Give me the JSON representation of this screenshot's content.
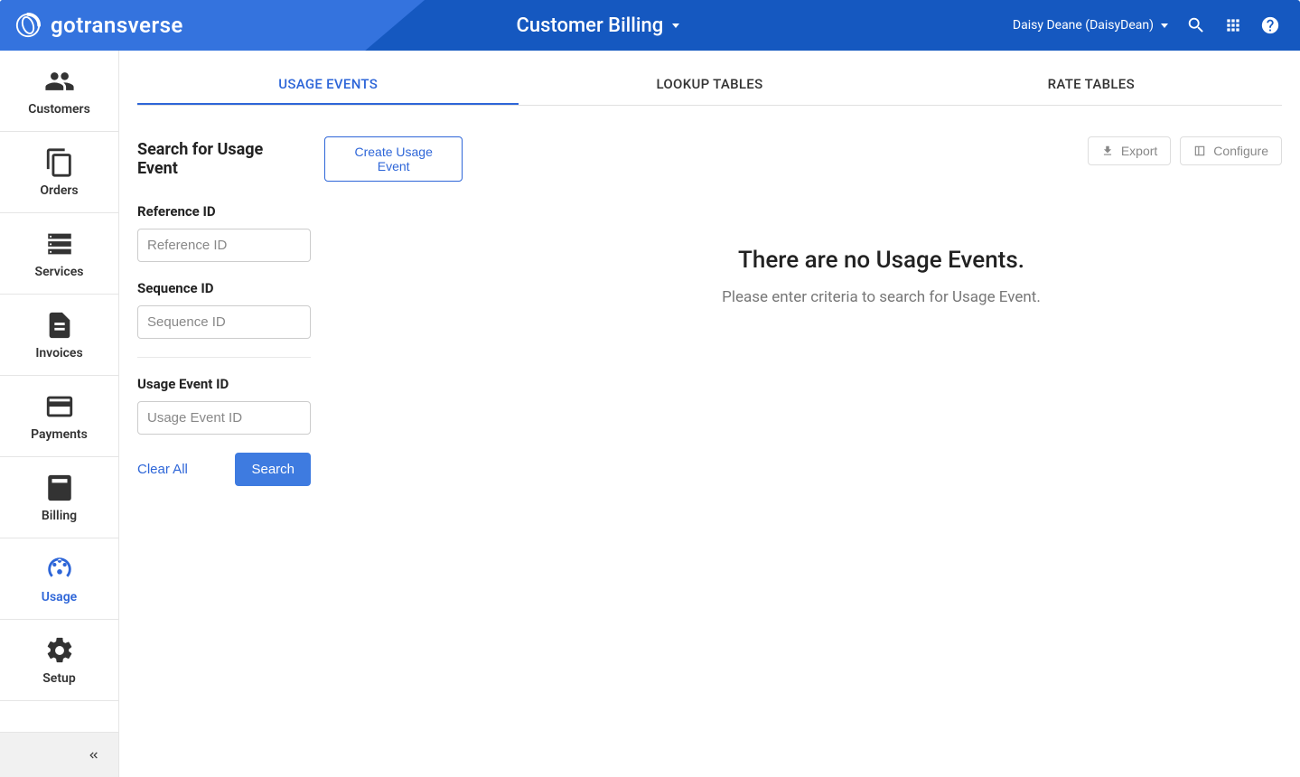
{
  "header": {
    "brand": "gotransverse",
    "title": "Customer Billing",
    "user": "Daisy Deane (DaisyDean)"
  },
  "sidebar": {
    "items": [
      {
        "label": "Customers"
      },
      {
        "label": "Orders"
      },
      {
        "label": "Services"
      },
      {
        "label": "Invoices"
      },
      {
        "label": "Payments"
      },
      {
        "label": "Billing"
      },
      {
        "label": "Usage"
      },
      {
        "label": "Setup"
      }
    ]
  },
  "tabs": [
    {
      "label": "USAGE EVENTS"
    },
    {
      "label": "LOOKUP TABLES"
    },
    {
      "label": "RATE TABLES"
    }
  ],
  "search": {
    "title": "Search for Usage Event",
    "create_label": "Create Usage Event",
    "fields": {
      "reference_id": {
        "label": "Reference ID",
        "placeholder": "Reference ID"
      },
      "sequence_id": {
        "label": "Sequence ID",
        "placeholder": "Sequence ID"
      },
      "usage_event_id": {
        "label": "Usage Event ID",
        "placeholder": "Usage Event ID"
      }
    },
    "clear_label": "Clear All",
    "search_label": "Search"
  },
  "results": {
    "export_label": "Export",
    "configure_label": "Configure",
    "empty_title": "There are no Usage Events.",
    "empty_sub": "Please enter criteria to search for Usage Event."
  }
}
